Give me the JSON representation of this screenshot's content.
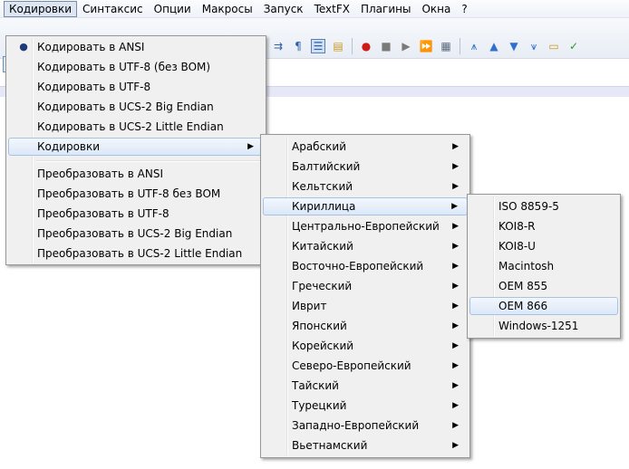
{
  "menubar": {
    "items": [
      "Кодировки",
      "Синтаксис",
      "Опции",
      "Макросы",
      "Запуск",
      "TextFX",
      "Плагины",
      "Окна",
      "?"
    ]
  },
  "toolbar": {
    "icons": [
      "word-wrap-icon",
      "pilcrow-icon",
      "indent-guide-icon",
      "doc-map-icon",
      "record-macro-icon",
      "stop-macro-icon",
      "play-macro-icon",
      "run-macro-multiple-icon",
      "save-macro-icon",
      "collapse-icon",
      "up-arrow-icon",
      "down-arrow-icon",
      "expand-icon",
      "folder-icon",
      "spellcheck-icon"
    ]
  },
  "encoding_menu": {
    "items": [
      {
        "label": "Кодировать в ANSI",
        "checked": true
      },
      {
        "label": "Кодировать в UTF-8 (без BOM)"
      },
      {
        "label": "Кодировать в UTF-8"
      },
      {
        "label": "Кодировать в UCS-2 Big Endian"
      },
      {
        "label": "Кодировать в UCS-2 Little Endian"
      },
      {
        "label": "Кодировки",
        "submenu": true
      },
      {
        "label": "Преобразовать в ANSI"
      },
      {
        "label": "Преобразовать в UTF-8 без BOM"
      },
      {
        "label": "Преобразовать в UTF-8"
      },
      {
        "label": "Преобразовать в UCS-2 Big Endian"
      },
      {
        "label": "Преобразовать в UCS-2 Little Endian"
      }
    ]
  },
  "charset_submenu": {
    "items": [
      "Арабский",
      "Балтийский",
      "Кельтский",
      "Кириллица",
      "Центрально-Европейский",
      "Китайский",
      "Восточно-Европейский",
      "Греческий",
      "Иврит",
      "Японский",
      "Корейский",
      "Северо-Европейский",
      "Тайский",
      "Турецкий",
      "Западно-Европейский",
      "Вьетнамский"
    ]
  },
  "cyrillic_submenu": {
    "items": [
      "ISO 8859-5",
      "KOI8-R",
      "KOI8-U",
      "Macintosh",
      "OEM 855",
      "OEM 866",
      "Windows-1251"
    ]
  },
  "colors": {
    "highlight_border": "#a9c2e4",
    "highlight_fill": "#dbe8f8",
    "menu_bg": "#f0f0f0"
  }
}
